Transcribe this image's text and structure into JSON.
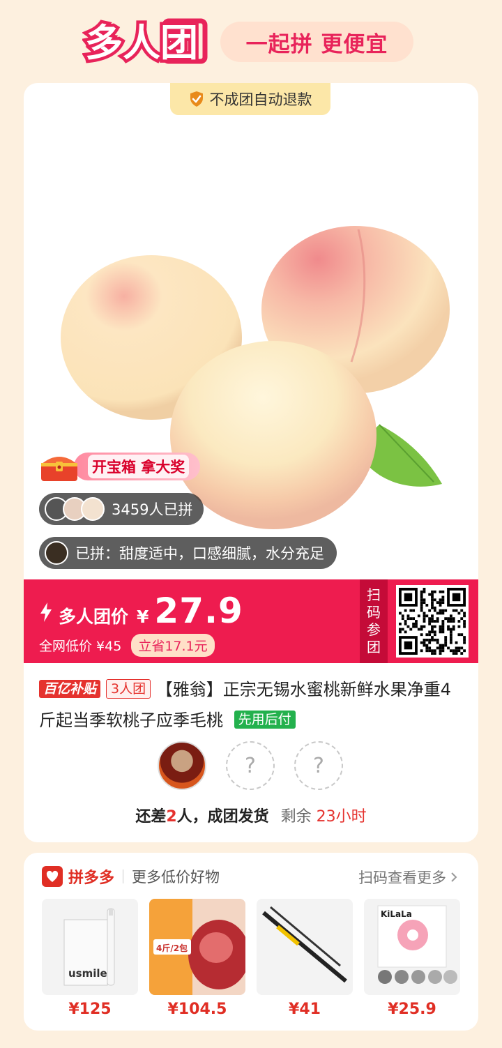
{
  "header": {
    "brand": "多人团",
    "slogan": "一起拼 更便宜"
  },
  "product": {
    "refund_badge": "不成团自动退款",
    "treasure_text": "开宝箱 拿大奖",
    "joined_count": "3459人已拼",
    "review": "已拼：甜度适中，口感细腻，水分充足",
    "price_label": "多人团价",
    "currency": "¥",
    "price": "27.9",
    "lowest_price": "全网低价 ¥45",
    "save": "立省17.1元",
    "scan_label": [
      "扫",
      "码",
      "参",
      "团"
    ],
    "tags": {
      "subsidy": "百亿补贴",
      "group": "3人团",
      "pay_later": "先用后付"
    },
    "title": "【雅翁】正宗无锡水蜜桃新鲜水果净重4斤起当季软桃子应季毛桃",
    "group_status_prefix": "还差",
    "group_status_count": "2",
    "group_status_suffix": "人，成团发货",
    "remaining_label": "剩余",
    "remaining_time": "23小时",
    "slot_placeholder": "?"
  },
  "recommend": {
    "brand": "拼多多",
    "subtitle": "更多低价好物",
    "scan_more": "扫码查看更多",
    "items": [
      {
        "price": "¥125",
        "image_text": "usmile"
      },
      {
        "price": "¥104.5",
        "image_text": "4斤/2包"
      },
      {
        "price": "¥41",
        "image_text": ""
      },
      {
        "price": "¥25.9",
        "image_text": "KiLaLa"
      }
    ]
  },
  "colors": {
    "accent": "#ee1c4f",
    "background": "#fdf0df",
    "pdd_red": "#e02e24",
    "green_tag": "#23b14d"
  },
  "icons": [
    "shield-check-icon",
    "treasure-chest-icon",
    "lightning-icon",
    "qr-code-icon",
    "pdd-logo-icon",
    "chevron-right-icon"
  ]
}
